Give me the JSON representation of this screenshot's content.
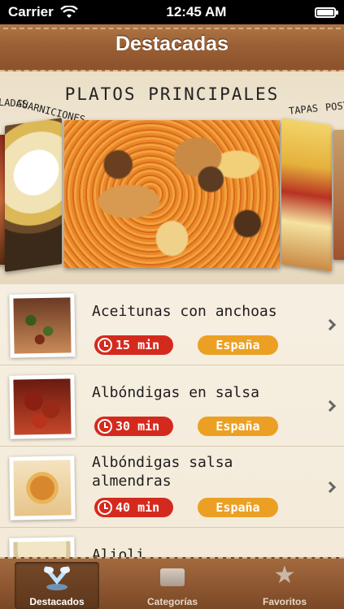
{
  "status_bar": {
    "carrier": "Carrier",
    "time": "12:45 AM"
  },
  "header": {
    "title": "Destacadas"
  },
  "carousel": {
    "selected_category": "PLATOS PRINCIPALES",
    "side_categories": [
      "LADAS",
      "GUARNICIONES",
      "TAPAS",
      "POST"
    ]
  },
  "recipes": [
    {
      "title": "Aceitunas con anchoas",
      "time": "15 min",
      "origin": "España",
      "image": "olives-anchovies"
    },
    {
      "title": "Albóndigas en salsa",
      "time": "30 min",
      "origin": "España",
      "image": "meatballs-sauce"
    },
    {
      "title": "Albóndigas salsa almendras",
      "time": "40 min",
      "origin": "España",
      "image": "meatballs-almonds"
    },
    {
      "title": "Alioli",
      "time": "",
      "origin": "",
      "image": "alioli"
    }
  ],
  "tabbar": {
    "active": "Destacados",
    "tabs": [
      {
        "label": "Destacados",
        "icon": "fork-knife-icon"
      },
      {
        "label": "Categorías",
        "icon": "tray-icon"
      },
      {
        "label": "Favoritos",
        "icon": "star-icon"
      }
    ]
  },
  "colors": {
    "time_badge": "#d42a1e",
    "origin_badge": "#eba024",
    "leather": "#9c6035"
  }
}
